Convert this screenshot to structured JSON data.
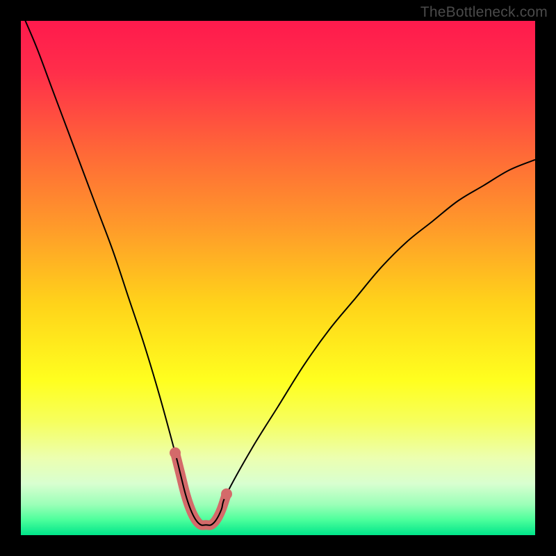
{
  "watermark": "TheBottleneck.com",
  "chart_data": {
    "type": "line",
    "title": "",
    "xlabel": "",
    "ylabel": "",
    "xlim": [
      0,
      100
    ],
    "ylim": [
      0,
      100
    ],
    "background": {
      "type": "vertical-gradient",
      "stops": [
        {
          "pos": 0.0,
          "color": "#ff1a4d"
        },
        {
          "pos": 0.1,
          "color": "#ff2e4a"
        },
        {
          "pos": 0.25,
          "color": "#ff6638"
        },
        {
          "pos": 0.4,
          "color": "#ff9a2a"
        },
        {
          "pos": 0.55,
          "color": "#ffd31a"
        },
        {
          "pos": 0.7,
          "color": "#ffff1f"
        },
        {
          "pos": 0.78,
          "color": "#f6ff5e"
        },
        {
          "pos": 0.85,
          "color": "#ecffb0"
        },
        {
          "pos": 0.9,
          "color": "#d8ffd0"
        },
        {
          "pos": 0.94,
          "color": "#9cffb8"
        },
        {
          "pos": 0.97,
          "color": "#4dff9c"
        },
        {
          "pos": 1.0,
          "color": "#00e58a"
        }
      ]
    },
    "series": [
      {
        "name": "bottleneck-curve",
        "color": "#000000",
        "stroke_width": 2,
        "x": [
          0,
          3,
          6,
          9,
          12,
          15,
          18,
          21,
          24,
          27,
          30,
          31,
          32,
          33,
          34,
          35,
          36,
          37,
          38,
          39,
          40,
          45,
          50,
          55,
          60,
          65,
          70,
          75,
          80,
          85,
          90,
          95,
          100
        ],
        "values": [
          102,
          95,
          87,
          79,
          71,
          63,
          55,
          46,
          37,
          27,
          16,
          12,
          8,
          5,
          3,
          2,
          2,
          2,
          3,
          5,
          8,
          17,
          25,
          33,
          40,
          46,
          52,
          57,
          61,
          65,
          68,
          71,
          73
        ]
      },
      {
        "name": "valley-highlight",
        "color": "#d46a6a",
        "stroke_width": 14,
        "linecap": "round",
        "x": [
          30,
          31,
          32,
          33,
          34,
          35,
          36,
          37,
          38,
          39,
          40
        ],
        "values": [
          16,
          12,
          8,
          5,
          3,
          2,
          2,
          2,
          3,
          5,
          8
        ]
      }
    ],
    "markers": [
      {
        "name": "valley-dot-left",
        "x": 30,
        "y": 16,
        "r": 8,
        "color": "#d46a6a"
      },
      {
        "name": "valley-dot-right",
        "x": 40,
        "y": 8,
        "r": 8,
        "color": "#d46a6a"
      }
    ]
  }
}
